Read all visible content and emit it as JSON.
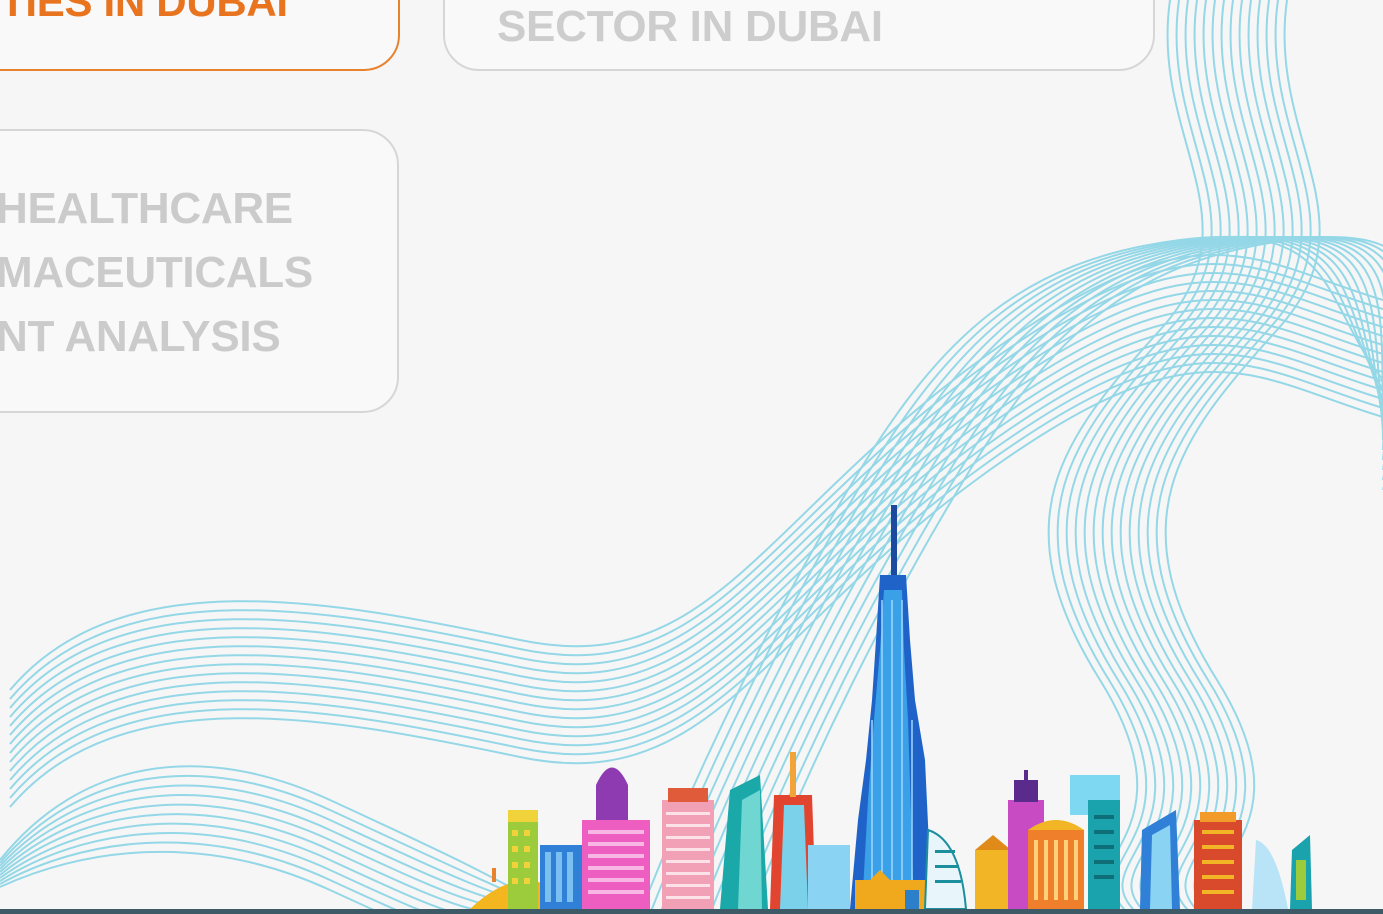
{
  "cards": {
    "top_left": {
      "text": "TIES IN DUBAI"
    },
    "top_center": {
      "text": "SECTOR IN DUBAI"
    },
    "left": {
      "lines": [
        "HEALTHCARE",
        "MACEUTICALS",
        "NT ANALYSIS"
      ]
    }
  },
  "colors": {
    "accent_orange": "#e8822e",
    "card_border_grey": "#d6d6d6",
    "muted_text": "#cbcbcb",
    "wave_blue": "#6ccde3",
    "background": "#f6f6f6"
  },
  "illustration": {
    "icon": "dubai-skyline-illustration",
    "decoration": "blue-wave-lines"
  }
}
